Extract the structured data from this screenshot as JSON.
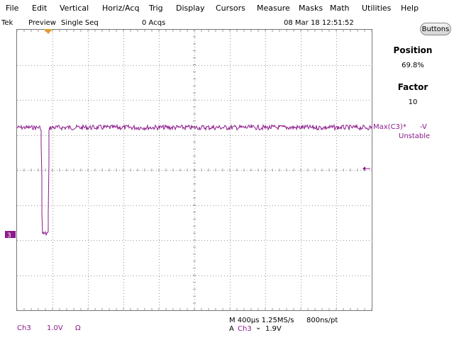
{
  "menu": [
    "File",
    "Edit",
    "Vertical",
    "Horiz/Acq",
    "Trig",
    "Display",
    "Cursors",
    "Measure",
    "Masks",
    "Math",
    "Utilities",
    "Help"
  ],
  "status": {
    "brand": "Tek",
    "mode": "Preview",
    "seq": "Single Seq",
    "acqs": "0 Acqs",
    "datetime": "08 Mar 18 12:51:52"
  },
  "buttons_label": "Buttons",
  "side": {
    "position_label": "Position",
    "position_value": "69.8%",
    "factor_label": "Factor",
    "factor_value": "10"
  },
  "measurement": {
    "label": "Max(C3)*",
    "value": "-V",
    "state": "Unstable"
  },
  "channel_marker": "3",
  "bottom": {
    "channel": "Ch3",
    "scale": "1.0V",
    "termination": "Ω",
    "timebase": "M 400µs 1.25MS/s",
    "record": "800ns/pt",
    "trigger_prefix": "A",
    "trigger_channel": "Ch3",
    "trigger_slope": "⌄",
    "trigger_level": "1.9V"
  },
  "colors": {
    "trace": "#8b1a8b",
    "marker": "#e39a2c",
    "grid": "#9a9a9a"
  }
}
